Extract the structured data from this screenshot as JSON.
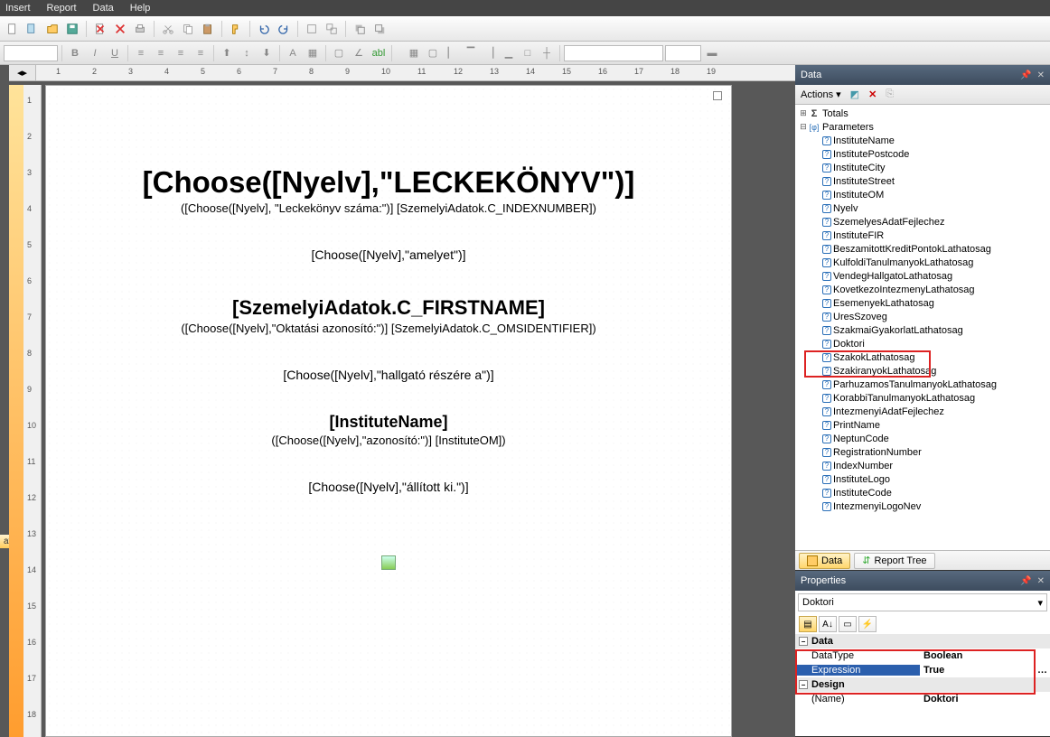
{
  "menus": [
    "Insert",
    "Report",
    "Data",
    "Help"
  ],
  "ruler_h": [
    1,
    2,
    3,
    4,
    5,
    6,
    7,
    8,
    9,
    10,
    11,
    12,
    13,
    14,
    15,
    16,
    17,
    18,
    19
  ],
  "ruler_v": [
    1,
    2,
    3,
    4,
    5,
    6,
    7,
    8,
    9,
    10,
    11,
    12,
    13,
    14,
    15,
    16,
    17,
    18
  ],
  "doc": {
    "title": "[Choose([Nyelv],\"LECKEKÖNYV\")]",
    "sub1": "([Choose([Nyelv], \"Leckekönyv száma:\")]  [SzemelyiAdatok.C_INDEXNUMBER])",
    "amelyet": "[Choose([Nyelv],\"amelyet\")]",
    "name": "[SzemelyiAdatok.C_FIRSTNAME]",
    "sub2": "([Choose([Nyelv],\"Oktatási  azonosító:\")]  [SzemelyiAdatok.C_OMSIDENTIFIER])",
    "hallgato": "[Choose([Nyelv],\"hallgató részére a\")]",
    "inst": "[InstituteName]",
    "sub3": "([Choose([Nyelv],\"azonosító:\")]  [InstituteOM])",
    "allitott": "[Choose([Nyelv],\"állított ki.\")]"
  },
  "left_tab": "atok",
  "data_panel": {
    "title": "Data",
    "actions_label": "Actions",
    "totals": "Totals",
    "parameters": "Parameters",
    "params": [
      "InstituteName",
      "InstitutePostcode",
      "InstituteCity",
      "InstituteStreet",
      "InstituteOM",
      "Nyelv",
      "SzemelyesAdatFejlechez",
      "InstituteFIR",
      "BeszamitottKreditPontokLathatosag",
      "KulfoldiTanulmanyokLathatosag",
      "VendegHallgatoLathatosag",
      "KovetkezoIntezmenyLathatosag",
      "EsemenyekLathatosag",
      "UresSzoveg",
      "SzakmaiGyakorlatLathatosag",
      "Doktori",
      "SzakokLathatosag",
      "SzakiranyokLathatosag",
      "ParhuzamosTanulmanyokLathatosag",
      "KorabbiTanulmanyokLathatosag",
      "IntezmenyiAdatFejlechez",
      "PrintName",
      "NeptunCode",
      "RegistrationNumber",
      "IndexNumber",
      "InstituteLogo",
      "InstituteCode",
      "IntezmenyiLogoNev"
    ],
    "tabs": {
      "data": "Data",
      "report_tree": "Report Tree"
    }
  },
  "props": {
    "title": "Properties",
    "object": "Doktori",
    "cat_data": "Data",
    "cat_design": "Design",
    "rows": {
      "datatype_k": "DataType",
      "datatype_v": "Boolean",
      "expression_k": "Expression",
      "expression_v": "True",
      "name_k": "(Name)",
      "name_v": "Doktori"
    }
  }
}
